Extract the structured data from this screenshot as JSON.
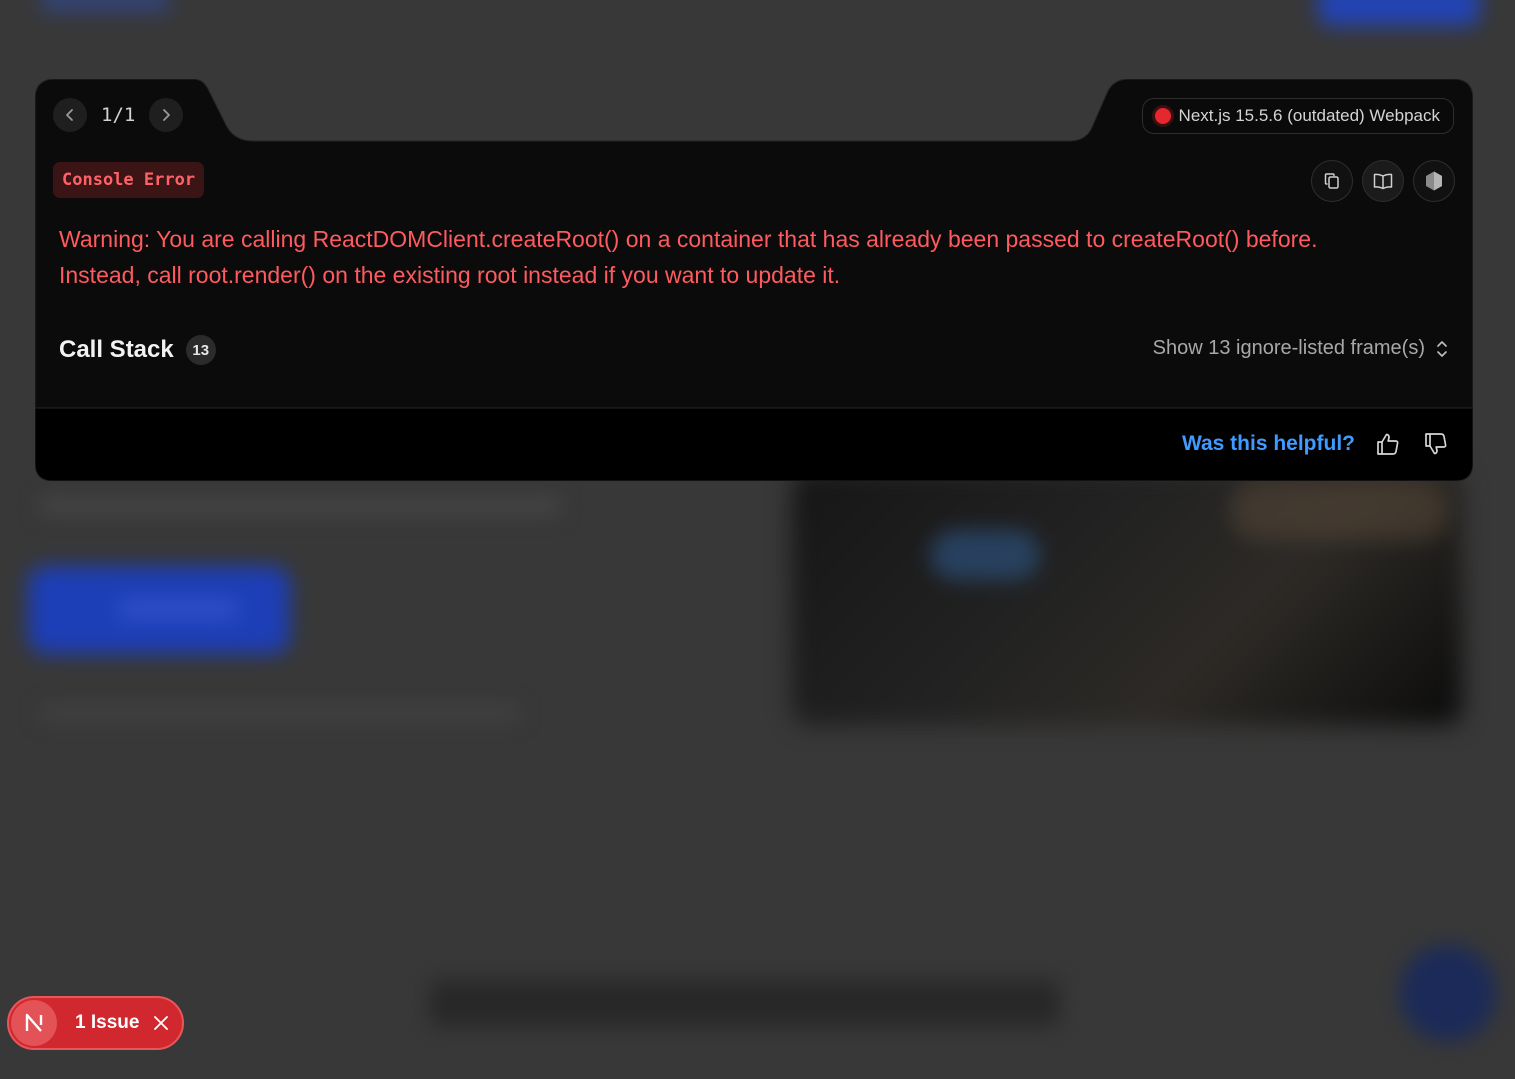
{
  "navigation": {
    "page_count": "1/1",
    "prev_icon": "chevron-left-icon",
    "next_icon": "chevron-right-icon"
  },
  "version": {
    "label": "Next.js 15.5.6 (outdated) Webpack",
    "status_color": "#e5282d"
  },
  "error": {
    "badge": "Console Error",
    "message_line1": "Warning: You are calling ReactDOMClient.createRoot() on a container that has already been passed to createRoot() before.",
    "message_line2": "Instead, call root.render() on the existing root instead if you want to update it.",
    "color": "#ff5a5f"
  },
  "toolbar": {
    "icons": [
      "copy-icon",
      "book-icon",
      "node-icon"
    ]
  },
  "call_stack": {
    "title": "Call Stack",
    "count": "13",
    "toggle_label": "Show 13 ignore-listed frame(s)"
  },
  "feedback": {
    "prompt": "Was this helpful?",
    "color": "#3f9bff"
  },
  "issue_indicator": {
    "label": "1 Issue",
    "logo": "N"
  }
}
